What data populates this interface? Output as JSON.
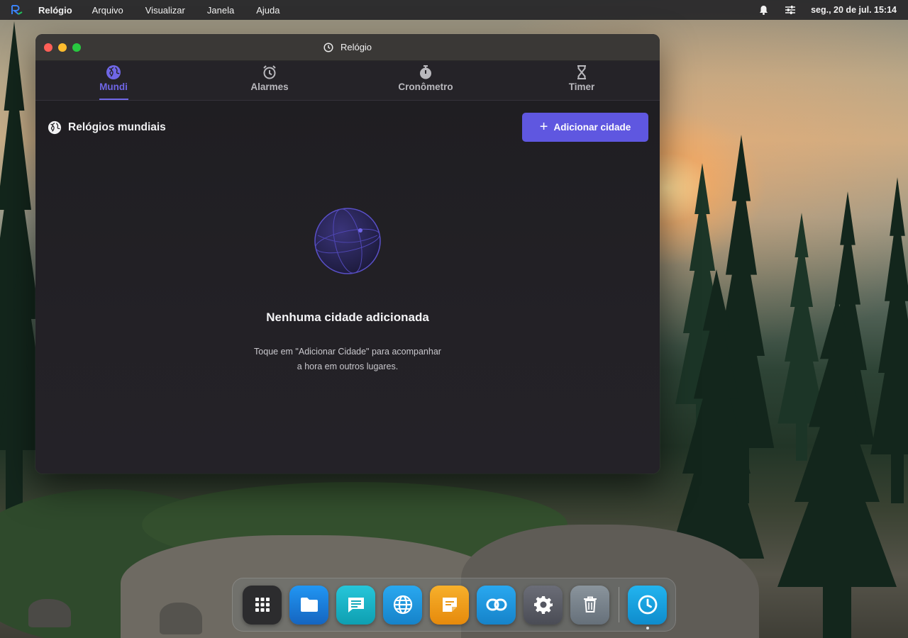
{
  "menubar": {
    "app_name": "Relógio",
    "items": [
      "Arquivo",
      "Visualizar",
      "Janela",
      "Ajuda"
    ],
    "datetime": "seg., 20 de jul. 15:14",
    "icons": [
      "bell-icon",
      "sliders-icon"
    ]
  },
  "window": {
    "title": "Relógio",
    "tabs": [
      {
        "label": "Mundi",
        "icon": "globe-icon",
        "active": true
      },
      {
        "label": "Alarmes",
        "icon": "alarm-icon",
        "active": false
      },
      {
        "label": "Cronômetro",
        "icon": "stopwatch-icon",
        "active": false
      },
      {
        "label": "Timer",
        "icon": "hourglass-icon",
        "active": false
      }
    ],
    "section_title": "Relógios mundiais",
    "add_button_label": "Adicionar cidade",
    "empty_state": {
      "title": "Nenhuma cidade adicionada",
      "description_line1": "Toque em \"Adicionar Cidade\" para acompanhar",
      "description_line2": "a hora em outros lugares."
    }
  },
  "dock": {
    "items": [
      {
        "name": "app-grid",
        "color": "#2c2c2e"
      },
      {
        "name": "files",
        "color": "#1e88e5"
      },
      {
        "name": "messages",
        "color": "#1fb8c8"
      },
      {
        "name": "browser",
        "color": "#1e9be0"
      },
      {
        "name": "notes",
        "color": "#f0a020"
      },
      {
        "name": "links",
        "color": "#1e9be0"
      },
      {
        "name": "settings",
        "color": "#5b5d66"
      },
      {
        "name": "trash",
        "color": "#77818a"
      },
      {
        "name": "clock",
        "color": "#1aa3e0",
        "running": true
      }
    ]
  },
  "colors": {
    "accent": "#5f57e0",
    "tab_active": "#6f66e6"
  }
}
